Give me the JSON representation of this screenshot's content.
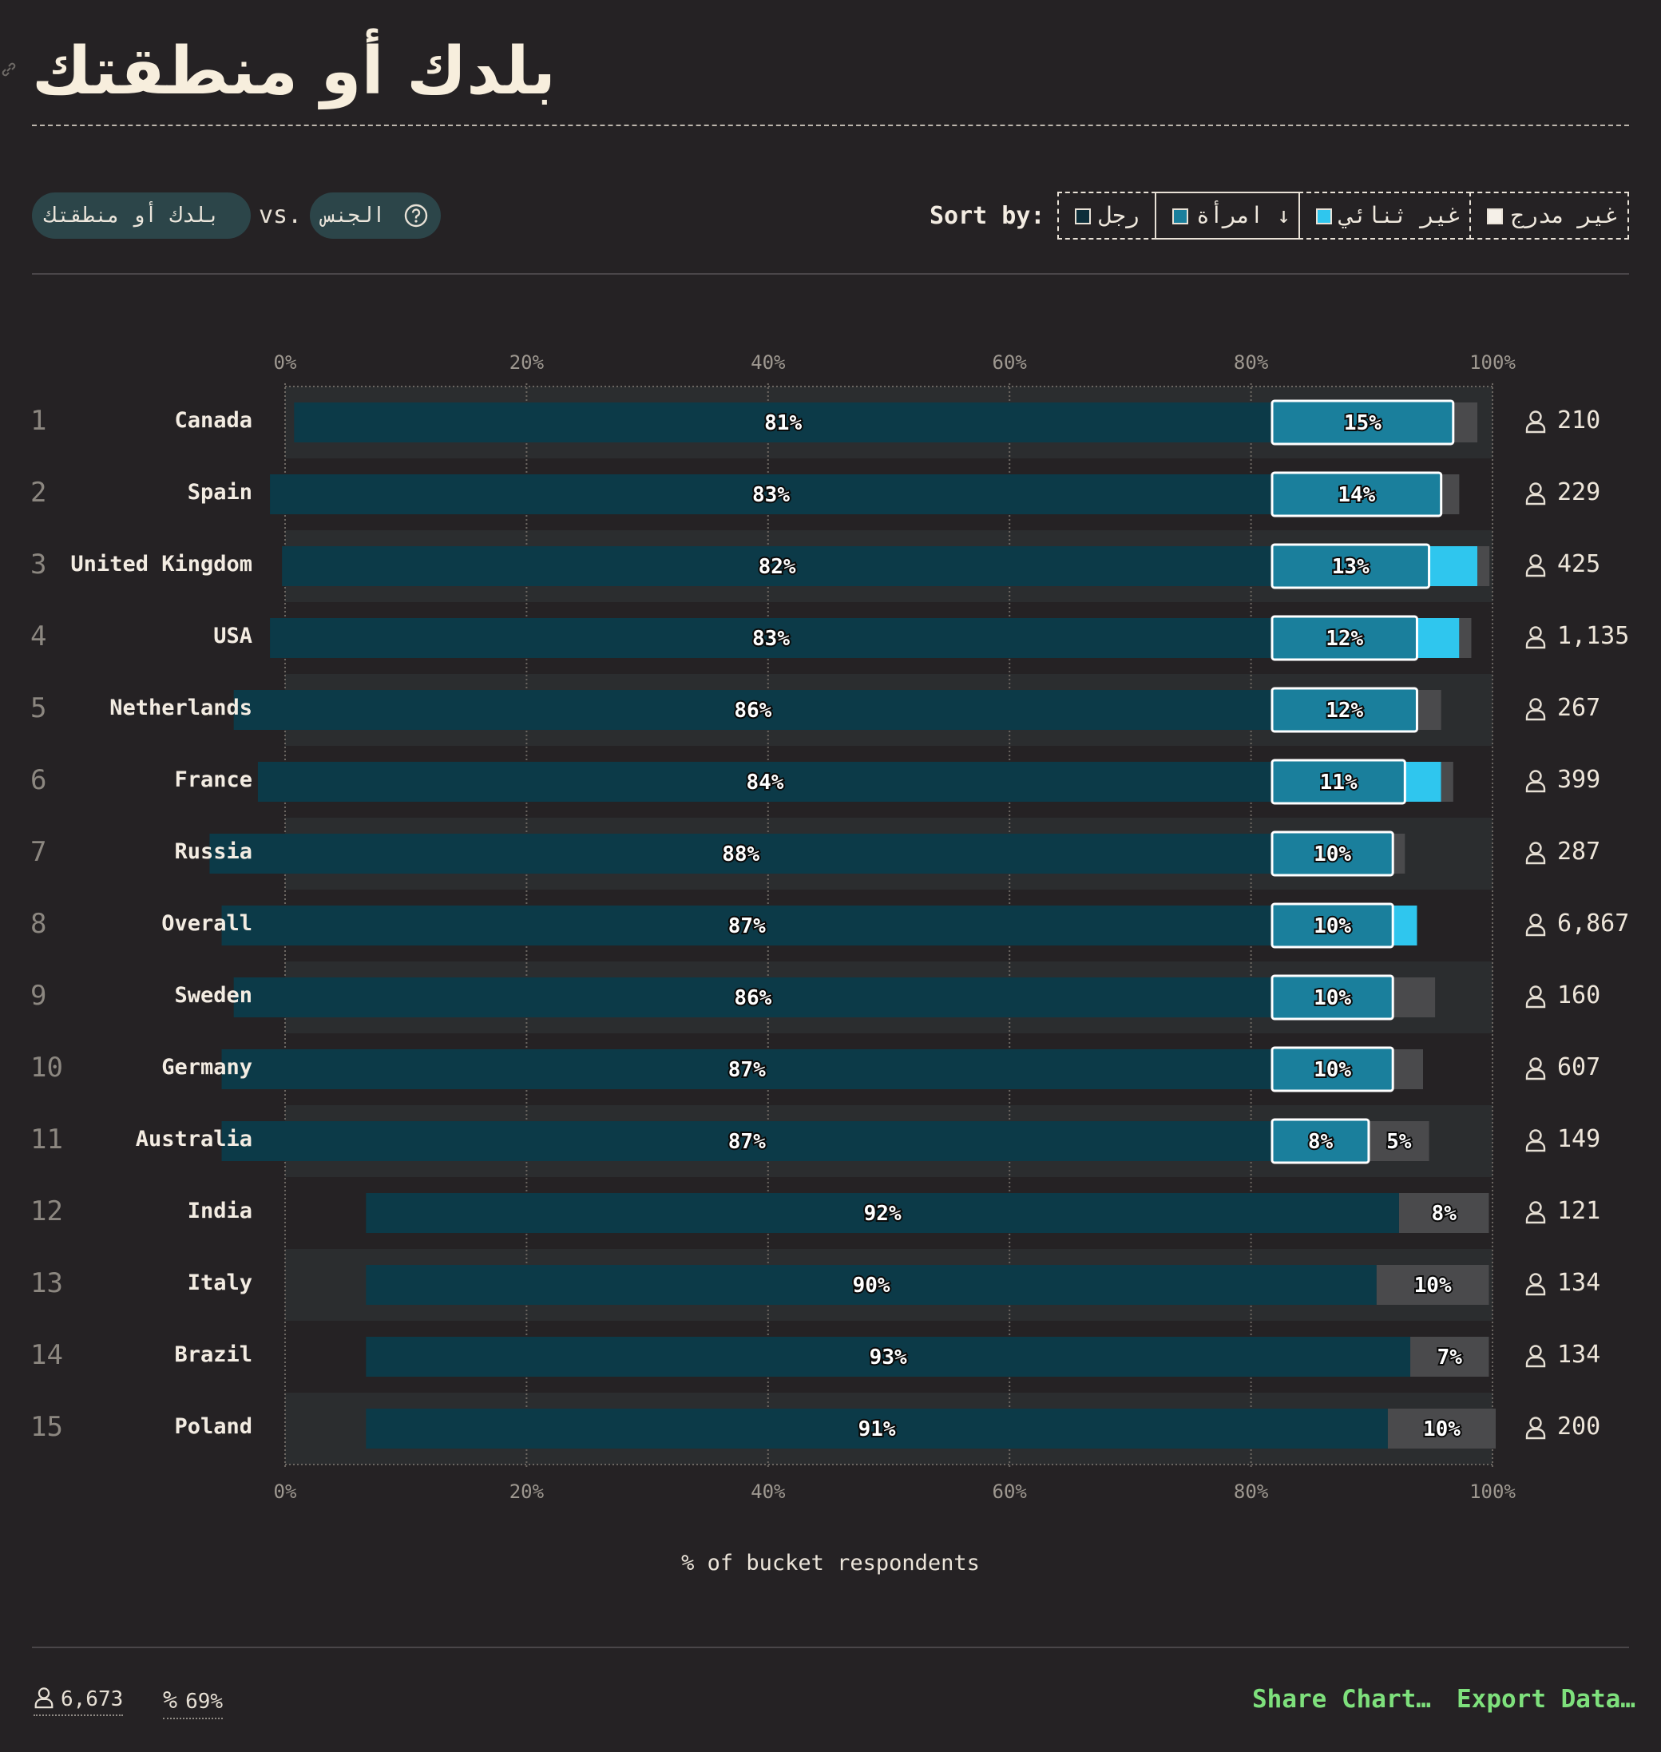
{
  "title": "بلدك أو منطقتك",
  "controls": {
    "pill_left": "بلدك أو منطقتك",
    "vs": "vs.",
    "pill_right": "الجنس",
    "sort_label": "Sort by:",
    "sort_options": [
      {
        "label": "رجل",
        "color": "#0c2e3a"
      },
      {
        "label": "امرأة ↓",
        "color": "#1a7f9c"
      },
      {
        "label": "غير ثنائي",
        "color": "#2fc6ee"
      },
      {
        "label": "غير مدرج",
        "color": "#f5f0e8"
      }
    ]
  },
  "chart_data": {
    "type": "bar",
    "stacked": true,
    "orientation": "horizontal",
    "xlabel": "% of bucket respondents",
    "xlim": [
      0,
      100
    ],
    "x_ticks": [
      "0%",
      "20%",
      "40%",
      "60%",
      "80%",
      "100%"
    ],
    "categories": [
      "Canada",
      "Spain",
      "United Kingdom",
      "USA",
      "Netherlands",
      "France",
      "Russia",
      "Overall",
      "Sweden",
      "Germany",
      "Australia",
      "India",
      "Italy",
      "Brazil",
      "Poland"
    ],
    "ranks": [
      "1",
      "2",
      "3",
      "4",
      "5",
      "6",
      "7",
      "8",
      "9",
      "10",
      "11",
      "12",
      "13",
      "14",
      "15"
    ],
    "counts": [
      "210",
      "229",
      "425",
      "1,135",
      "267",
      "399",
      "287",
      "6,867",
      "160",
      "607",
      "149",
      "121",
      "134",
      "134",
      "200"
    ],
    "series": [
      {
        "name": "رجل",
        "color": "#0c3a48",
        "values": [
          81,
          83,
          82,
          83,
          86,
          84,
          88,
          87,
          86,
          87,
          87,
          92,
          90,
          93,
          91
        ],
        "labels": [
          "81%",
          "83%",
          "82%",
          "83%",
          "86%",
          "84%",
          "88%",
          "87%",
          "86%",
          "87%",
          "87%",
          "92%",
          "90%",
          "93%",
          "91%"
        ]
      },
      {
        "name": "امرأة",
        "color": "#1a7f9c",
        "values": [
          15,
          14,
          13,
          12,
          12,
          11,
          10,
          10,
          10,
          10,
          8,
          null,
          null,
          null,
          null
        ],
        "labels": [
          "15%",
          "14%",
          "13%",
          "12%",
          "12%",
          "11%",
          "10%",
          "10%",
          "10%",
          "10%",
          "8%",
          "",
          "",
          "",
          ""
        ]
      },
      {
        "name": "غير ثنائي",
        "color": "#2fc6ee",
        "values": [
          0,
          0,
          4,
          3.5,
          0,
          3,
          0,
          2,
          0,
          0,
          0,
          0,
          0,
          0,
          0
        ],
        "labels": []
      },
      {
        "name": "غير مدرج",
        "color": "#4a4a4c",
        "values": [
          2,
          1.5,
          1,
          1,
          2,
          1,
          1,
          0,
          3.5,
          2.5,
          5,
          8,
          10,
          7,
          10
        ],
        "labels": [
          "",
          "",
          "",
          "",
          "",
          "",
          "",
          "",
          "",
          "",
          "5%",
          "8%",
          "10%",
          "7%",
          "10%"
        ]
      }
    ]
  },
  "footer": {
    "respondents": "6,673",
    "percent": "69%",
    "share": "Share Chart…",
    "export": "Export Data…"
  }
}
